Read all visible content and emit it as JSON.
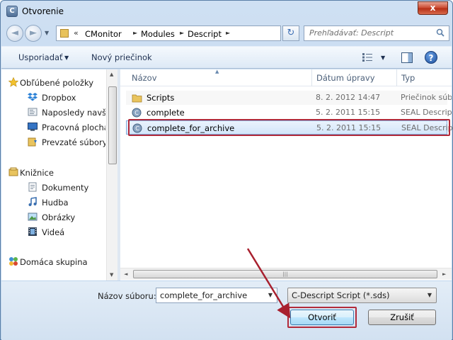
{
  "window": {
    "title": "Otvorenie",
    "app_icon_letter": "C",
    "close_label": "x"
  },
  "address": {
    "back_label": "◄",
    "forward_label": "►",
    "overflow": "«",
    "path": [
      "CMonitor",
      "Modules",
      "Descript"
    ],
    "search_placeholder": "Prehľadávať: Descript"
  },
  "toolbar": {
    "organize_label": "Usporiadať",
    "new_folder_label": "Nový priečinok",
    "help_label": "?"
  },
  "nav_pane": {
    "favorites": {
      "label": "Obľúbené položky",
      "items": [
        "Dropbox",
        "Naposledy navštívené",
        "Pracovná plocha",
        "Prevzaté súbory"
      ]
    },
    "libraries": {
      "label": "Knižnice",
      "items": [
        "Dokumenty",
        "Hudba",
        "Obrázky",
        "Videá"
      ]
    },
    "homegroup": {
      "label": "Domáca skupina"
    }
  },
  "file_list": {
    "columns": [
      "Názov",
      "Dátum úpravy",
      "Typ"
    ],
    "rows": [
      {
        "name": "Scripts",
        "date": "8. 2. 2012 14:47",
        "type": "Priečinok súborov",
        "icon": "folder-icon"
      },
      {
        "name": "complete",
        "date": "5. 2. 2011 15:15",
        "type": "SEAL Descript",
        "icon": "script-file-icon"
      },
      {
        "name": "complete_for_archive",
        "date": "5. 2. 2011 15:15",
        "type": "SEAL Descript",
        "icon": "script-file-icon",
        "selected": true
      }
    ]
  },
  "bottom": {
    "file_name_label": "Názov súboru:",
    "file_name_value": "complete_for_archive",
    "filter_value": "C-Descript Script (*.sds)",
    "open_label": "Otvoriť",
    "cancel_label": "Zrušiť"
  },
  "colors": {
    "highlight_border": "#b22a3a",
    "selection_fill": "#d3e6fa",
    "window_frame": "#cfe0f3"
  }
}
